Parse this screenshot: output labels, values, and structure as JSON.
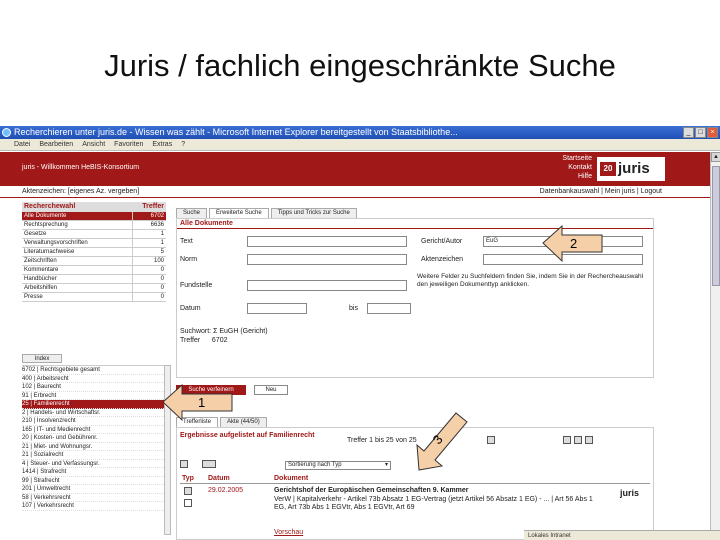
{
  "slide": {
    "title": "Juris / fachlich eingeschränkte Suche"
  },
  "browser": {
    "title": "Recherchieren unter juris.de - Wissen was zählt - Microsoft Internet Explorer bereitgestellt von Staatsbibliothe...",
    "menu": [
      "Datei",
      "Bearbeiten",
      "Ansicht",
      "Favoriten",
      "Extras",
      "?"
    ],
    "status": "Lokales Intranet"
  },
  "header": {
    "welcome": "juris - Willkommen HeBIS-Konsortium",
    "links": [
      "Startseite",
      "Kontakt",
      "Hilfe"
    ],
    "logo_text": "juris",
    "logo_mark": "20",
    "aktenzeichen": "Aktenzeichen: [eigenes Az. vergeben]",
    "nav_right": "Datenbankauswahl | Mein juris | Logout"
  },
  "left_panel": {
    "head_name": "Recherchewahl",
    "head_count": "Treffer",
    "rows": [
      {
        "name": "Alle Dokumente",
        "count": "6702",
        "selected": true
      },
      {
        "name": "Rechtsprechung",
        "count": "6636"
      },
      {
        "name": "Gesetze",
        "count": "1"
      },
      {
        "name": "Verwaltungsvorschriften",
        "count": "1"
      },
      {
        "name": "Literaturnachweise",
        "count": "5"
      },
      {
        "name": "Zeitschriften",
        "count": "100"
      },
      {
        "name": "Kommentare",
        "count": "0"
      },
      {
        "name": "Handbücher",
        "count": "0"
      },
      {
        "name": "Arbeitshilfen",
        "count": "0"
      },
      {
        "name": "Presse",
        "count": "0"
      }
    ],
    "index_tab": "Index",
    "tree": [
      "6702 | Rechtsgebiete gesamt",
      "400 | Arbeitsrecht",
      "102 | Baurecht",
      "91 | Erbrecht",
      "25 | Familienrecht",
      "2 | Handels- und Wirtschaftsr.",
      "210 | Insolvenzrecht",
      "165 | IT- und Medienrecht",
      "20 | Kosten- und Gebührenr.",
      "21 | Miet- und Wohnungsr.",
      "21 | Sozialrecht",
      "4 | Steuer- und Verfassungsr.",
      "1414 | Strafrecht",
      "99 | Strafrecht",
      "201 | Umweltrecht",
      "58 | Verkehrsrecht",
      "107 | Verkehrsrecht"
    ]
  },
  "tabs": [
    "Suche",
    "Erweiterte Suche",
    "Tipps und Tricks zur Suche"
  ],
  "form": {
    "heading": "Alle Dokumente",
    "labels": {
      "text": "Text",
      "norm": "Norm",
      "fundstelle": "Fundstelle",
      "datum": "Datum",
      "bis": "bis",
      "gericht": "Gericht/Autor",
      "aktenzeichen": "Aktenzeichen"
    },
    "gericht_value": "EuG",
    "hint": "Weitere Felder zu Suchfeldern finden Sie, indem Sie in der Rechercheauswahl den jeweiligen Dokumenttyp anklicken.",
    "suchwort": "Suchwort: Σ EuGH (Gericht)",
    "treffer_label": "Treffer",
    "treffer_value": "6702",
    "btn_search": "Suche verfeinern",
    "btn_new": "Neu"
  },
  "results": {
    "tabs": [
      "Trefferliste",
      "Akte (44/50)"
    ],
    "title": "Ergebnisse aufgelistet auf Familienrecht",
    "count": "Treffer 1 bis 25 von 25",
    "sort": "Sortierung nach Typ",
    "columns": {
      "typ": "Typ",
      "datum": "Datum",
      "dokument": "Dokument"
    },
    "doc": {
      "date": "29.02.2005",
      "court": "Gerichtshof der Europäischen Gemeinschaften 9. Kammer",
      "text": "VerW | Kapitalverkehr - Artikel 73b Absatz 1 EG-Vertrag (jetzt Artikel 56 Absatz 1 EG) - ... | Art 56 Abs 1 EG, Art 73b Abs 1 EGVtr, Abs 1 EGVtr, Art 69",
      "link": "Vorschau",
      "logo": "juris"
    }
  },
  "annotations": {
    "one": "1",
    "two": "2",
    "three": "3"
  }
}
